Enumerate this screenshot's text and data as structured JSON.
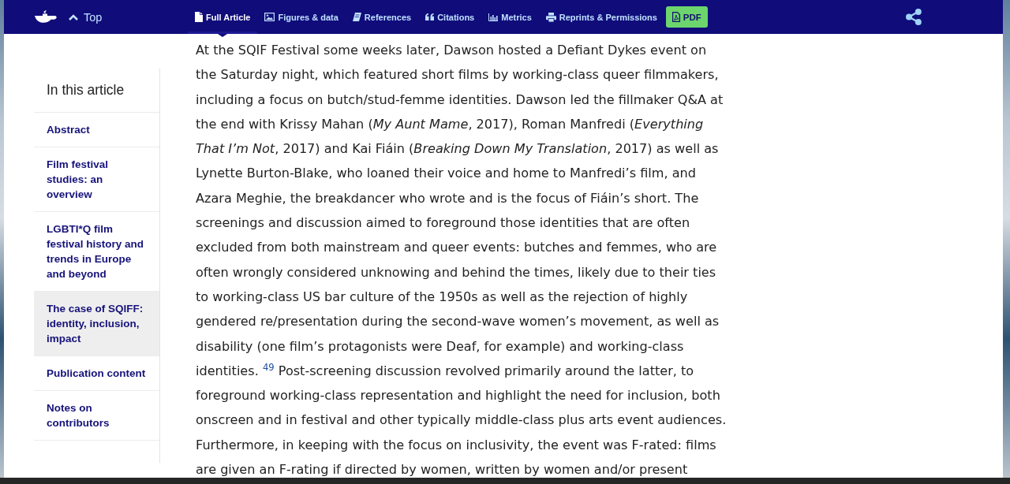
{
  "nav": {
    "top_link": "Top",
    "tabs": [
      {
        "label": "Full Article",
        "selected": true
      },
      {
        "label": "Figures & data",
        "selected": false
      },
      {
        "label": "References",
        "selected": false
      },
      {
        "label": "Citations",
        "selected": false
      },
      {
        "label": "Metrics",
        "selected": false
      }
    ],
    "reprints_link": "Reprints & Permissions",
    "pdf_button": "PDF"
  },
  "sidebar": {
    "title": "In this article",
    "items": [
      {
        "label": "Abstract",
        "selected": false
      },
      {
        "label": "Film festival studies: an overview",
        "selected": false
      },
      {
        "label": "LGBTI*Q film festival history and trends in Europe and beyond",
        "selected": false
      },
      {
        "label": "The case of SQIFF: identity, inclusion, impact",
        "selected": true
      },
      {
        "label": "Publication content",
        "selected": false
      },
      {
        "label": "Notes on contributors",
        "selected": false
      }
    ]
  },
  "article": {
    "paragraph": {
      "before": "At the SQIF Festival some weeks later, Dawson hosted a Defiant Dykes event on the Saturday night, which featured short films by working-class queer filmmakers, including a focus on butch/stud-femme identities. Dawson led the fillmaker Q&A at the end with Krissy Mahan (*My Aunt Mame*, 2017), Roman Manfredi (*Everything That I’m Not*, 2017) and Kai Fiáin (*Breaking Down My Translation*, 2017) as well as Lynette Burton-Blake, who loaned their voice and home to Manfredi’s film, and Azara Meghie, the breakdancer who wrote and is the focus of Fiáin’s short. The screenings and discussion aimed to foreground those identities that are often excluded from both mainstream and queer events: butches and femmes, who are often wrongly considered unknowing and behind the times, likely due to their ties to working-class US bar culture of the 1950s as well as the rejection of highly gendered re/presentation during the second-wave women’s movement, as well as disability (one film’s protagonists were Deaf, for example) and working-class identities.",
      "footnote": "49",
      "after": "Post-screening discussion revolved primarily around the latter, to foreground working-class representation and highlight the need for inclusion, both onscreen and in festival and other typically middle-class plus arts event audiences. Furthermore, in keeping with the focus on inclusivity, the event was F-rated: films are given an F-rating if directed by women, written by women and/or present"
    }
  }
}
